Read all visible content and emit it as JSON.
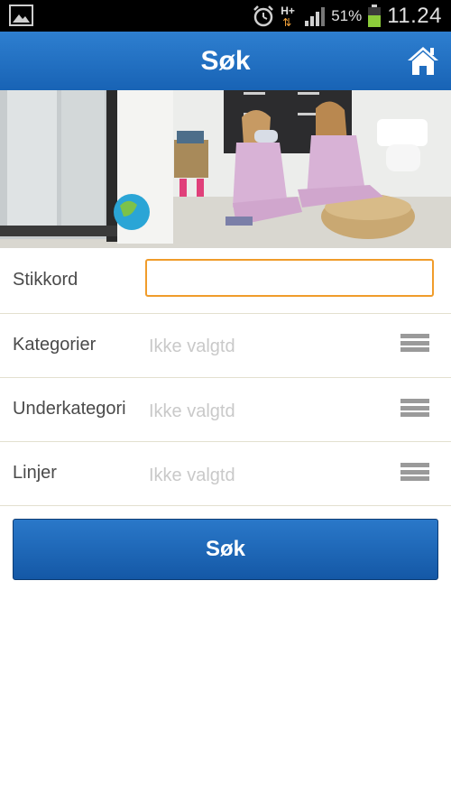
{
  "statusbar": {
    "battery_percent": "51%",
    "time": "11.24",
    "network_type": "H+",
    "icons": [
      "gallery-icon",
      "alarm-icon",
      "network-icon",
      "signal-icon",
      "battery-icon"
    ]
  },
  "header": {
    "title": "Søk",
    "home_icon": "home-icon",
    "color": "#1f6ec2"
  },
  "form": {
    "keyword": {
      "label": "Stikkord",
      "value": "",
      "placeholder": ""
    },
    "rows": [
      {
        "label": "Kategorier",
        "value": "Ikke valgtd",
        "icon": "list-icon"
      },
      {
        "label": "Underkategori",
        "value": "Ikke valgtd",
        "icon": "list-icon"
      },
      {
        "label": "Linjer",
        "value": "Ikke valgtd",
        "icon": "list-icon"
      }
    ]
  },
  "search_button": {
    "label": "Søk"
  },
  "colors": {
    "accent": "#1f6ec2",
    "focus": "#f09c2b"
  }
}
